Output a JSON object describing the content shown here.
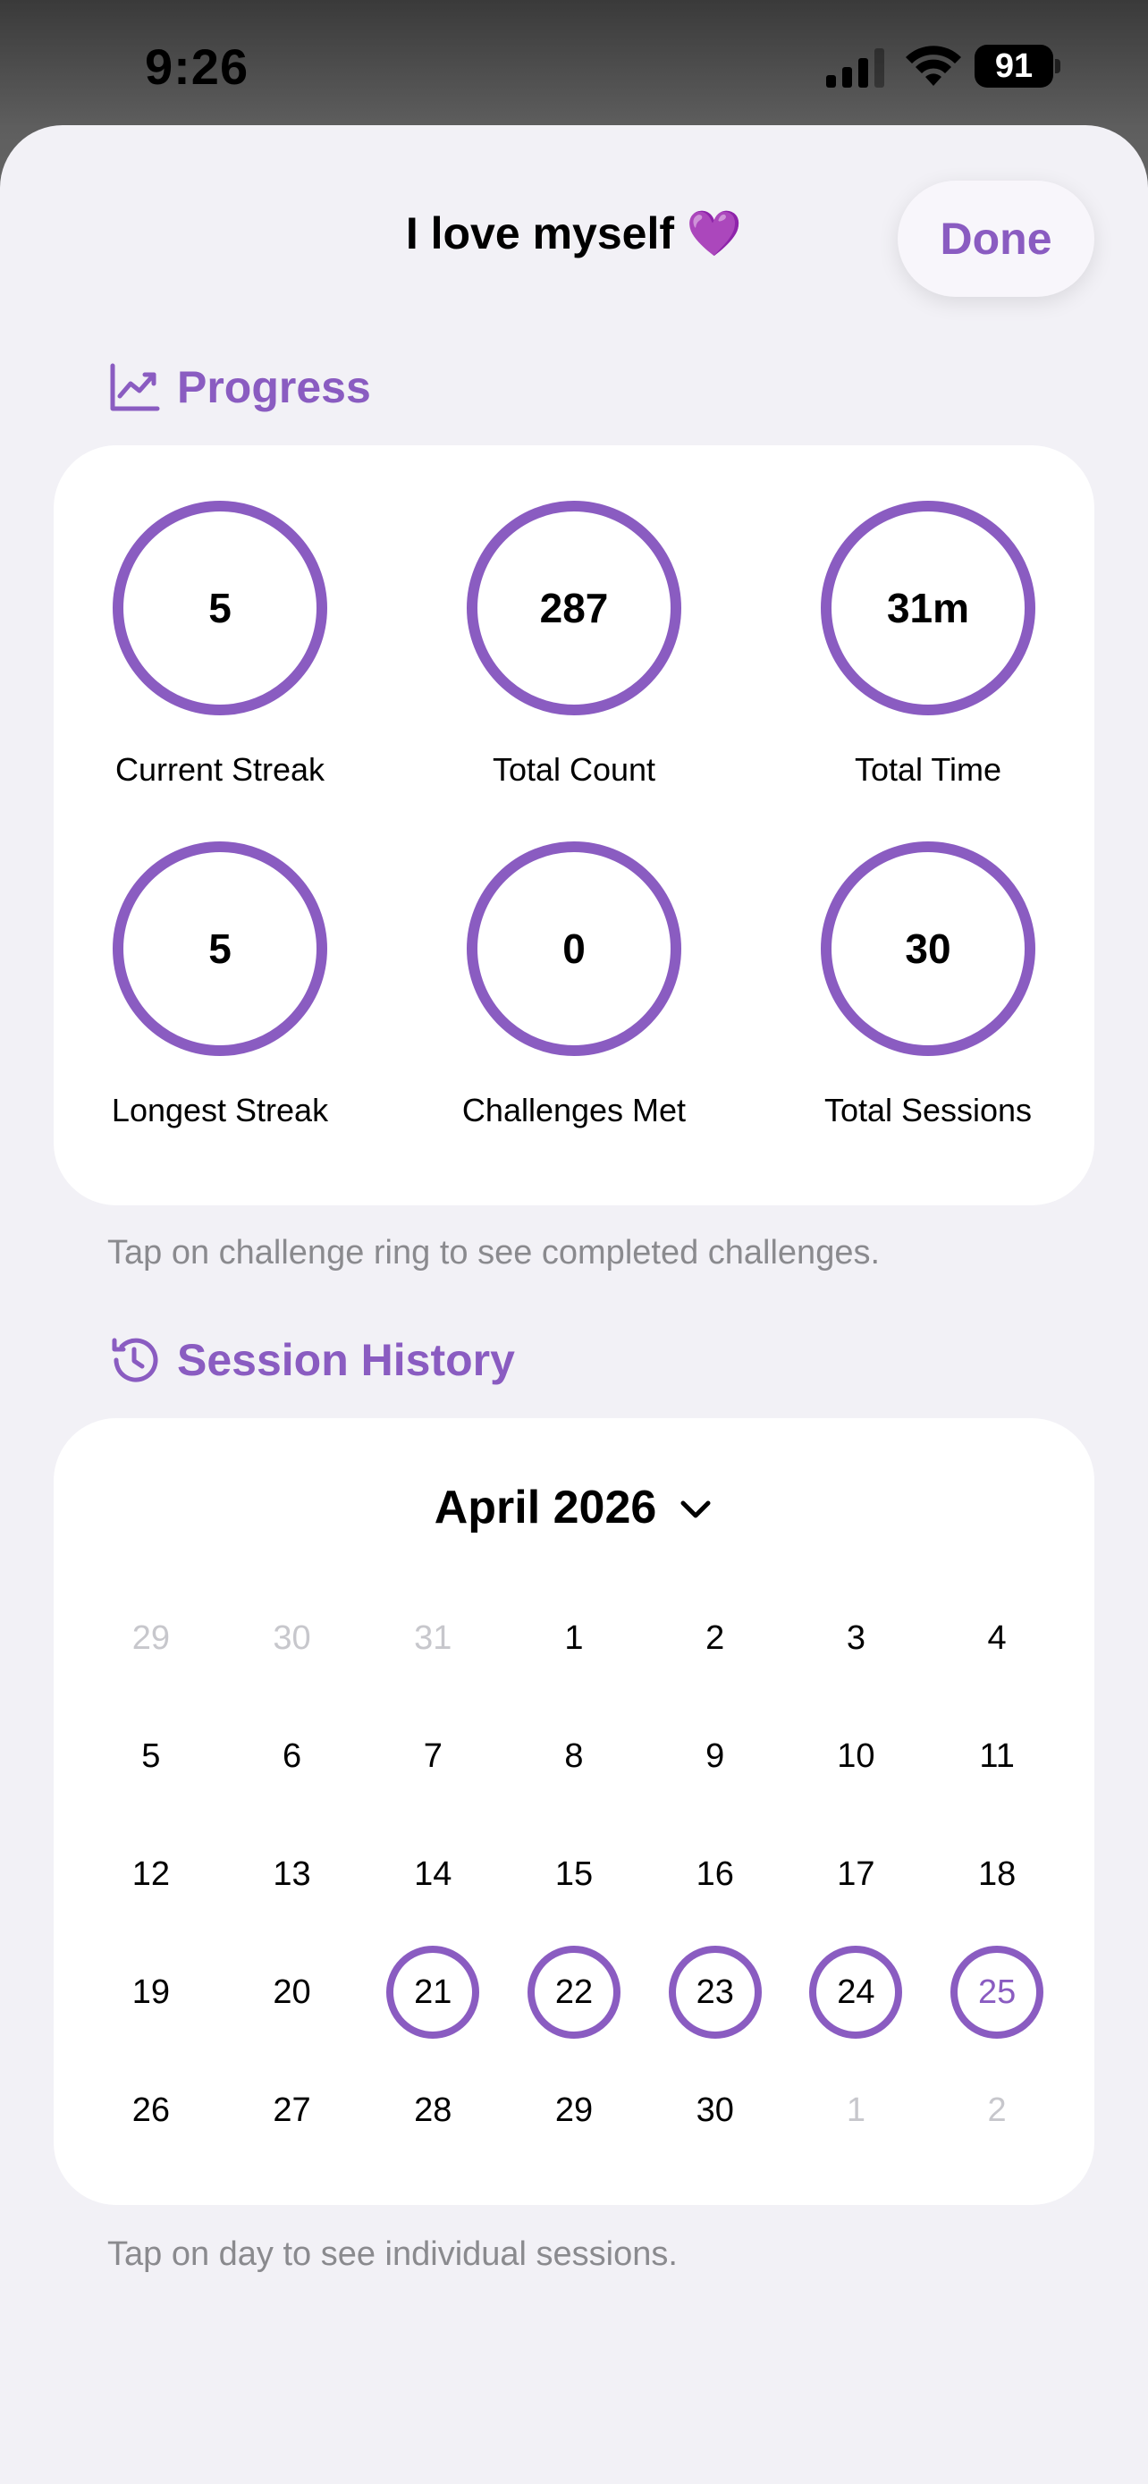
{
  "status_bar": {
    "time": "9:26",
    "battery": "91"
  },
  "sheet": {
    "title": "I love myself 💜",
    "done_label": "Done"
  },
  "progress": {
    "header": "Progress",
    "stats": [
      {
        "value": "5",
        "label": "Current Streak"
      },
      {
        "value": "287",
        "label": "Total Count"
      },
      {
        "value": "31m",
        "label": "Total Time"
      },
      {
        "value": "5",
        "label": "Longest Streak"
      },
      {
        "value": "0",
        "label": "Challenges Met"
      },
      {
        "value": "30",
        "label": "Total Sessions"
      }
    ],
    "footnote": "Tap on challenge ring to see completed challenges."
  },
  "history": {
    "header": "Session History",
    "month_label": "April 2026",
    "days": [
      {
        "label": "29",
        "muted": true,
        "session": false
      },
      {
        "label": "30",
        "muted": true,
        "session": false
      },
      {
        "label": "31",
        "muted": true,
        "session": false
      },
      {
        "label": "1",
        "muted": false,
        "session": false
      },
      {
        "label": "2",
        "muted": false,
        "session": false
      },
      {
        "label": "3",
        "muted": false,
        "session": false
      },
      {
        "label": "4",
        "muted": false,
        "session": false
      },
      {
        "label": "5",
        "muted": false,
        "session": false
      },
      {
        "label": "6",
        "muted": false,
        "session": false
      },
      {
        "label": "7",
        "muted": false,
        "session": false
      },
      {
        "label": "8",
        "muted": false,
        "session": false
      },
      {
        "label": "9",
        "muted": false,
        "session": false
      },
      {
        "label": "10",
        "muted": false,
        "session": false
      },
      {
        "label": "11",
        "muted": false,
        "session": false
      },
      {
        "label": "12",
        "muted": false,
        "session": false
      },
      {
        "label": "13",
        "muted": false,
        "session": false
      },
      {
        "label": "14",
        "muted": false,
        "session": false
      },
      {
        "label": "15",
        "muted": false,
        "session": false
      },
      {
        "label": "16",
        "muted": false,
        "session": false
      },
      {
        "label": "17",
        "muted": false,
        "session": false
      },
      {
        "label": "18",
        "muted": false,
        "session": false
      },
      {
        "label": "19",
        "muted": false,
        "session": false
      },
      {
        "label": "20",
        "muted": false,
        "session": false
      },
      {
        "label": "21",
        "muted": false,
        "session": true
      },
      {
        "label": "22",
        "muted": false,
        "session": true
      },
      {
        "label": "23",
        "muted": false,
        "session": true
      },
      {
        "label": "24",
        "muted": false,
        "session": true
      },
      {
        "label": "25",
        "muted": false,
        "session": true,
        "today": true
      },
      {
        "label": "26",
        "muted": false,
        "session": false
      },
      {
        "label": "27",
        "muted": false,
        "session": false
      },
      {
        "label": "28",
        "muted": false,
        "session": false
      },
      {
        "label": "29",
        "muted": false,
        "session": false
      },
      {
        "label": "30",
        "muted": false,
        "session": false
      },
      {
        "label": "1",
        "muted": true,
        "session": false
      },
      {
        "label": "2",
        "muted": true,
        "session": false
      }
    ],
    "footnote": "Tap on day to see individual sessions."
  },
  "colors": {
    "accent": "#8a5cc1",
    "sheet_bg": "#f2f1f6",
    "muted_text": "#8a8a8e"
  },
  "icons": {
    "progress": "chart-line-icon",
    "history": "clock-history-icon",
    "month": "chevron-down-icon"
  }
}
